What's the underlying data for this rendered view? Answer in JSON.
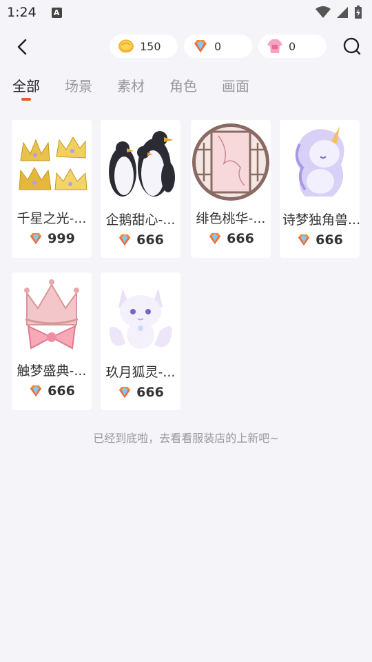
{
  "status_bar": {
    "time": "1:24",
    "notification_letter": "A"
  },
  "currency": {
    "gold": "150",
    "gem": "0",
    "shirt": "0"
  },
  "tabs": [
    {
      "label": "全部",
      "active": true
    },
    {
      "label": "场景",
      "active": false
    },
    {
      "label": "素材",
      "active": false
    },
    {
      "label": "角色",
      "active": false
    },
    {
      "label": "画面",
      "active": false
    }
  ],
  "items": [
    {
      "name": "千星之光-...",
      "price": "999",
      "thumb": "crown-gold"
    },
    {
      "name": "企鹅甜心-...",
      "price": "666",
      "thumb": "penguins"
    },
    {
      "name": "绯色桃华-...",
      "price": "666",
      "thumb": "round-window"
    },
    {
      "name": "诗梦独角兽...",
      "price": "666",
      "thumb": "unicorn"
    },
    {
      "name": "触梦盛典-...",
      "price": "666",
      "thumb": "crown-pink"
    },
    {
      "name": "玖月狐灵-...",
      "price": "666",
      "thumb": "fox"
    }
  ],
  "footer": {
    "end_text": "已经到底啦，去看看服装店的上新吧~"
  },
  "colors": {
    "accent": "#f0572e",
    "background": "#f4f4f9",
    "inactive_tab": "#999999"
  }
}
